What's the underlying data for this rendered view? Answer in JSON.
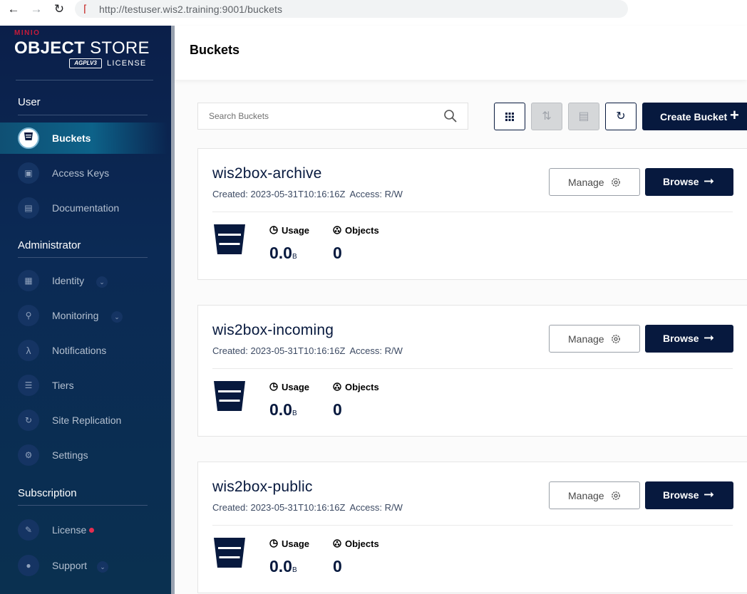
{
  "browser": {
    "url": "http://testuser.wis2.training:9001/buckets"
  },
  "logo": {
    "brand": "MINIO",
    "product_bold": "OBJECT",
    "product_light": "STORE",
    "badge": "AGPLV3",
    "license": "LICENSE"
  },
  "sidebar": {
    "sections": {
      "user": "User",
      "administrator": "Administrator",
      "subscription": "Subscription"
    },
    "items": [
      {
        "label": "Buckets",
        "icon": "bucket-icon",
        "active": true
      },
      {
        "label": "Access Keys",
        "icon": "key-icon"
      },
      {
        "label": "Documentation",
        "icon": "document-icon"
      },
      {
        "label": "Identity",
        "icon": "identity-icon",
        "expandable": true
      },
      {
        "label": "Monitoring",
        "icon": "monitoring-icon",
        "expandable": true
      },
      {
        "label": "Notifications",
        "icon": "lambda-icon"
      },
      {
        "label": "Tiers",
        "icon": "tiers-icon"
      },
      {
        "label": "Site Replication",
        "icon": "replication-icon"
      },
      {
        "label": "Settings",
        "icon": "settings-icon"
      },
      {
        "label": "License",
        "icon": "license-icon",
        "alert_dot": true
      },
      {
        "label": "Support",
        "icon": "support-icon",
        "expandable": true
      }
    ]
  },
  "page": {
    "title": "Buckets"
  },
  "toolbar": {
    "search_placeholder": "Search Buckets",
    "create_label": "Create Bucket"
  },
  "buckets": [
    {
      "name": "wis2box-archive",
      "created": "Created: 2023-05-31T10:16:16Z",
      "access": "Access: R/W",
      "usage_label": "Usage",
      "usage_value": "0.0",
      "usage_unit": "B",
      "objects_label": "Objects",
      "objects_value": "0",
      "manage_label": "Manage",
      "browse_label": "Browse"
    },
    {
      "name": "wis2box-incoming",
      "created": "Created: 2023-05-31T10:16:16Z",
      "access": "Access: R/W",
      "usage_label": "Usage",
      "usage_value": "0.0",
      "usage_unit": "B",
      "objects_label": "Objects",
      "objects_value": "0",
      "manage_label": "Manage",
      "browse_label": "Browse"
    },
    {
      "name": "wis2box-public",
      "created": "Created: 2023-05-31T10:16:16Z",
      "access": "Access: R/W",
      "usage_label": "Usage",
      "usage_value": "0.0",
      "usage_unit": "B",
      "objects_label": "Objects",
      "objects_value": "0",
      "manage_label": "Manage",
      "browse_label": "Browse"
    }
  ],
  "colors": {
    "primary": "#07193e",
    "sidebar": "#0b2452",
    "alert": "#e52d4f"
  }
}
